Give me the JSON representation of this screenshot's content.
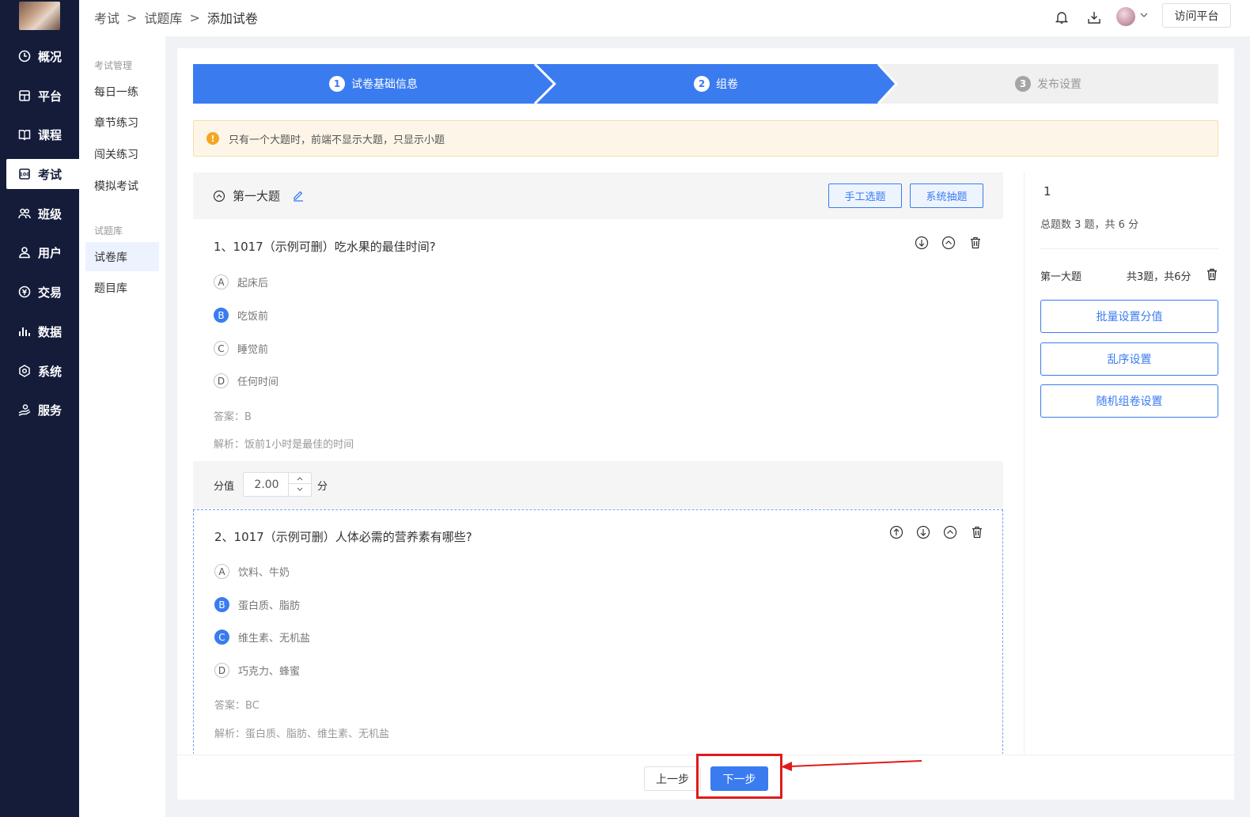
{
  "nav": {
    "items": [
      {
        "label": "概况",
        "icon": "overview-icon"
      },
      {
        "label": "平台",
        "icon": "platform-icon"
      },
      {
        "label": "课程",
        "icon": "course-icon"
      },
      {
        "label": "考试",
        "icon": "exam-icon"
      },
      {
        "label": "班级",
        "icon": "class-icon"
      },
      {
        "label": "用户",
        "icon": "user-icon"
      },
      {
        "label": "交易",
        "icon": "trade-icon"
      },
      {
        "label": "数据",
        "icon": "data-icon"
      },
      {
        "label": "系统",
        "icon": "system-icon"
      },
      {
        "label": "服务",
        "icon": "service-icon"
      }
    ],
    "active_index": 3
  },
  "submenu": {
    "group1": "考试管理",
    "group1_items": [
      "每日一练",
      "章节练习",
      "闯关练习",
      "模拟考试"
    ],
    "group2": "试题库",
    "group2_items": [
      "试卷库",
      "题目库"
    ],
    "active": "试卷库"
  },
  "breadcrumb": {
    "items": [
      "考试",
      "试题库",
      "添加试卷"
    ],
    "sep": ">"
  },
  "header": {
    "visit_label": "访问平台",
    "icons": [
      "bell-icon",
      "download-icon",
      "avatar",
      "chevron-down-icon"
    ]
  },
  "steps": [
    {
      "num": "1",
      "label": "试卷基础信息",
      "state": "done"
    },
    {
      "num": "2",
      "label": "组卷",
      "state": "current"
    },
    {
      "num": "3",
      "label": "发布设置",
      "state": "todo"
    }
  ],
  "alert": {
    "icon": "!",
    "text": "只有一个大题时，前端不显示大题，只显示小题"
  },
  "section": {
    "title": "第一大题",
    "manual_btn": "手工选题",
    "system_btn": "系统抽题"
  },
  "questions": [
    {
      "title": "1、1017（示例可删）吃水果的最佳时间?",
      "options": [
        {
          "key": "A",
          "text": "起床后",
          "selected": false
        },
        {
          "key": "B",
          "text": "吃饭前",
          "selected": true
        },
        {
          "key": "C",
          "text": "睡觉前",
          "selected": false
        },
        {
          "key": "D",
          "text": "任何时间",
          "selected": false
        }
      ],
      "answer_label": "答案：",
      "answer": "B",
      "analysis_label": "解析：",
      "analysis": "饭前1小时是最佳的时间"
    },
    {
      "title": "2、1017（示例可删）人体必需的营养素有哪些?",
      "options": [
        {
          "key": "A",
          "text": "饮料、牛奶",
          "selected": false
        },
        {
          "key": "B",
          "text": "蛋白质、脂肪",
          "selected": true
        },
        {
          "key": "C",
          "text": "维生素、无机盐",
          "selected": true
        },
        {
          "key": "D",
          "text": "巧克力、蜂蜜",
          "selected": false
        }
      ],
      "answer_label": "答案：",
      "answer": "BC",
      "analysis_label": "解析：",
      "analysis": "蛋白质、脂肪、维生素、无机盐"
    }
  ],
  "score": {
    "label": "分值",
    "value": "2.00",
    "unit": "分"
  },
  "summary": {
    "count": "1",
    "total": "总题数 3 题，共 6 分",
    "section_name": "第一大题",
    "section_score": "共3题，共6分",
    "buttons": [
      "批量设置分值",
      "乱序设置",
      "随机组卷设置"
    ]
  },
  "footer": {
    "prev": "上一步",
    "next": "下一步"
  },
  "colors": {
    "primary": "#3a7cf0",
    "nav_bg": "#141c3a",
    "highlight": "#e11a1a",
    "warn": "#f5a623"
  }
}
